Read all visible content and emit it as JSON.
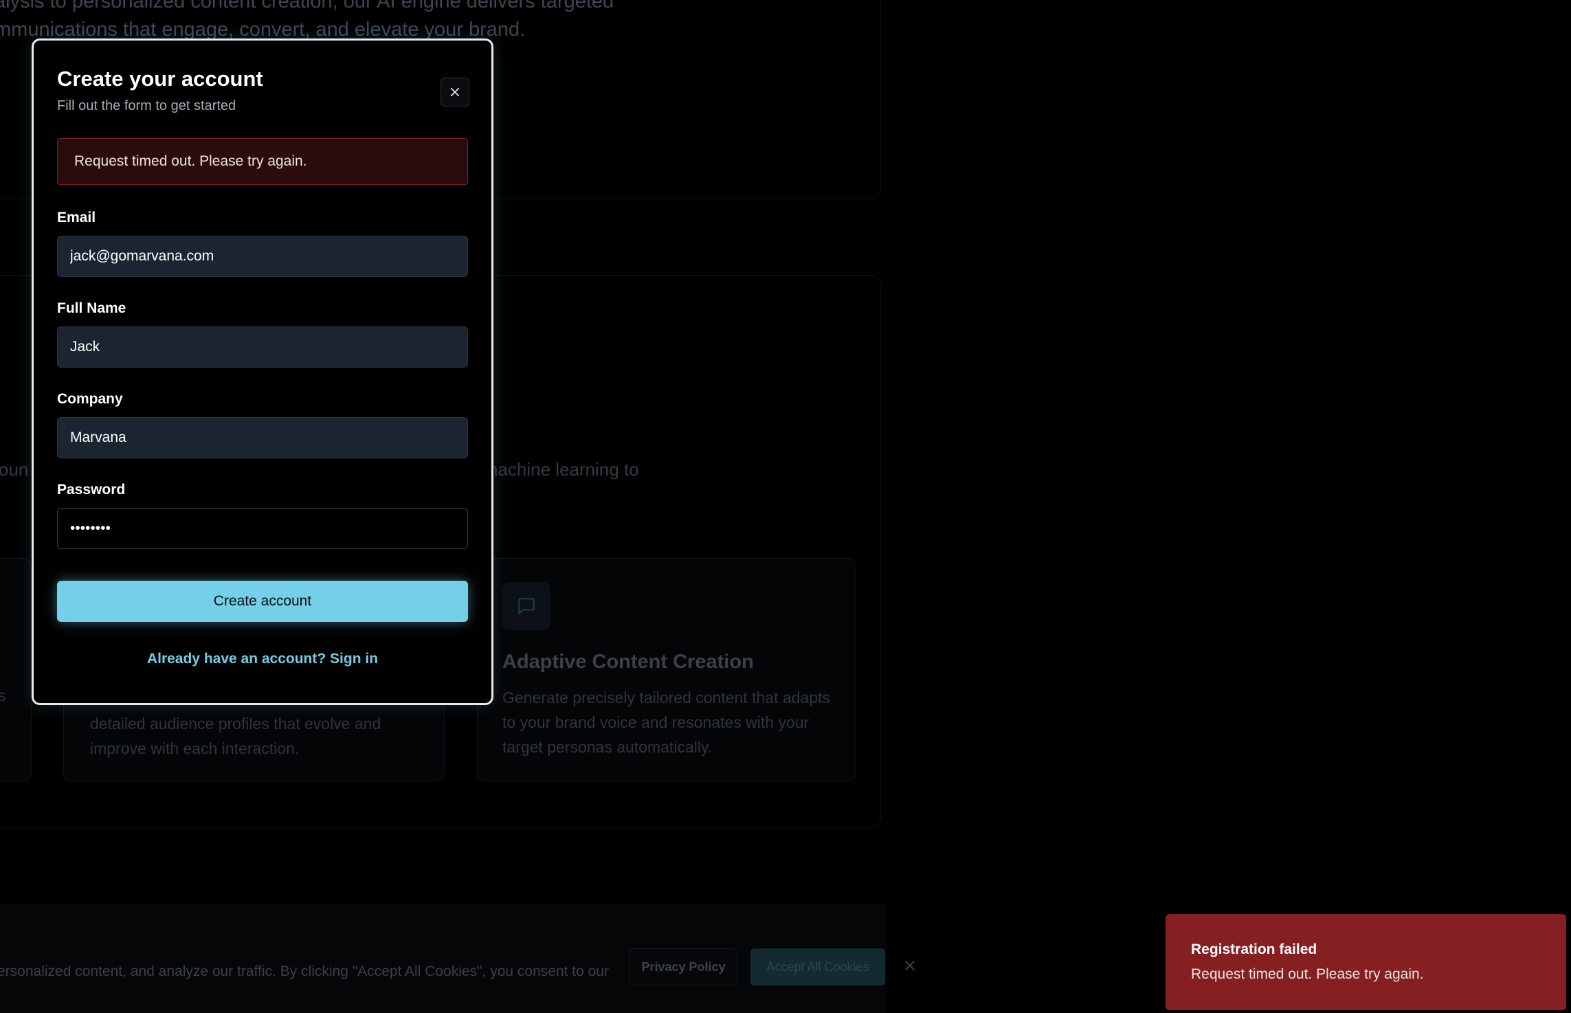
{
  "background": {
    "hero_line_1": "alysis to personalized content creation, our AI engine delivers targeted",
    "hero_line_2": "mmunications that engage, convert, and elevate your brand.",
    "tagline_left": "oun",
    "tagline_right": "nachine learning to",
    "card_left_fragment": "s",
    "card_mid_desc": "detailed audience profiles that evolve and improve with each interaction.",
    "card_right_title": "Adaptive Content Creation",
    "card_right_desc": "Generate precisely tailored content that adapts to your brand voice and resonates with your target personas automatically."
  },
  "cookie_bar": {
    "text": "ersonalized content, and analyze our traffic. By clicking \"Accept All Cookies\", you consent to our",
    "privacy_label": "Privacy Policy",
    "accept_label": "Accept All Cookies"
  },
  "modal": {
    "title": "Create your account",
    "subtitle": "Fill out the form to get started",
    "error": "Request timed out. Please try again.",
    "fields": {
      "email": {
        "label": "Email",
        "value": "jack@gomarvana.com"
      },
      "full_name": {
        "label": "Full Name",
        "value": "Jack"
      },
      "company": {
        "label": "Company",
        "value": "Marvana"
      },
      "password": {
        "label": "Password",
        "value": "••••••••"
      }
    },
    "submit_label": "Create account",
    "signin_link": "Already have an account? Sign in"
  },
  "toast": {
    "title": "Registration failed",
    "message": "Request timed out. Please try again."
  },
  "colors": {
    "accent": "#74d0e8",
    "error_bg": "#2b0c0e",
    "toast_bg": "#851f21"
  }
}
